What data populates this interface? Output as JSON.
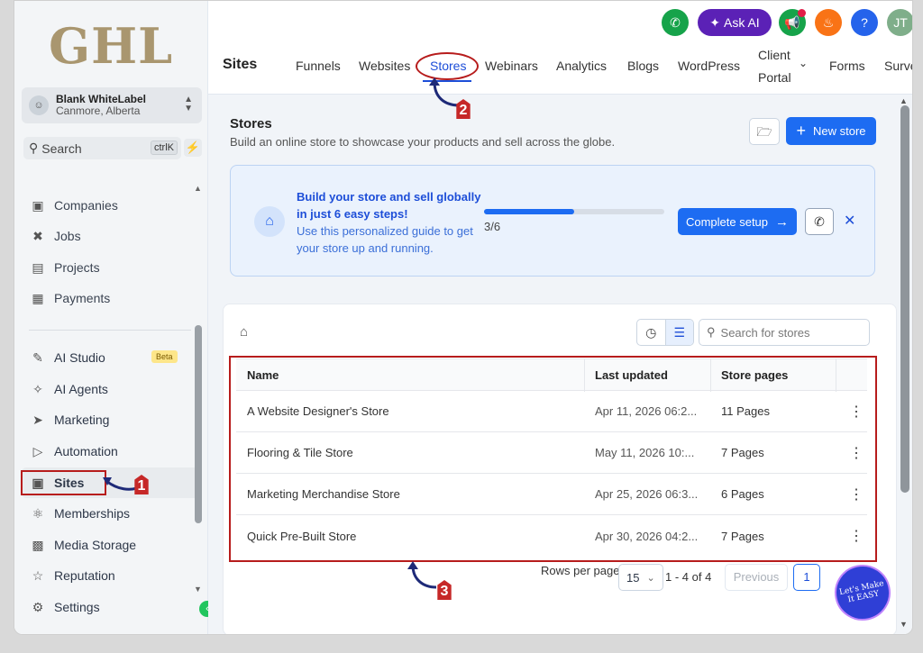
{
  "logo": "GHL",
  "account": {
    "name": "Blank WhiteLabel",
    "location": "Canmore, Alberta"
  },
  "search": {
    "label": "Search",
    "shortcut": "ctrlK"
  },
  "sidebar": {
    "items": [
      {
        "label": "Companies",
        "icon": "building-icon"
      },
      {
        "label": "Jobs",
        "icon": "tools-icon"
      },
      {
        "label": "Projects",
        "icon": "briefcase-icon"
      },
      {
        "label": "Payments",
        "icon": "invoice-icon"
      },
      {
        "label": "AI Studio",
        "icon": "ai-studio-icon"
      },
      {
        "label": "AI Agents",
        "icon": "sparkle-icon"
      },
      {
        "label": "Marketing",
        "icon": "send-icon"
      },
      {
        "label": "Automation",
        "icon": "automation-icon"
      },
      {
        "label": "Sites",
        "icon": "sites-icon"
      },
      {
        "label": "Memberships",
        "icon": "badge-icon"
      },
      {
        "label": "Media Storage",
        "icon": "image-icon"
      },
      {
        "label": "Reputation",
        "icon": "star-icon"
      },
      {
        "label": "Settings",
        "icon": "gear-icon"
      }
    ],
    "beta_label": "Beta"
  },
  "header": {
    "ask_ai": "Ask AI",
    "help": "?",
    "user_initials": "JT",
    "section_title": "Sites",
    "tabs": [
      {
        "label": "Funnels"
      },
      {
        "label": "Websites"
      },
      {
        "label": "Stores"
      },
      {
        "label": "Webinars"
      },
      {
        "label": "Analytics"
      },
      {
        "label": "Blogs"
      },
      {
        "label": "WordPress"
      },
      {
        "label": "Client"
      },
      {
        "label": "Portal"
      },
      {
        "label": "Forms"
      },
      {
        "label": "Surveys"
      }
    ]
  },
  "page": {
    "title": "Stores",
    "subtitle": "Build an online store to showcase your products and sell across the globe.",
    "new_store": "New store"
  },
  "setup": {
    "title": "Build your store and sell globally in just 6 easy steps!",
    "desc": "Use this personalized guide to get your store up and running.",
    "progress_label": "3/6",
    "progress_fraction": 0.5,
    "complete_button": "Complete setup"
  },
  "list": {
    "search_placeholder": "Search for stores",
    "columns": [
      "Name",
      "Last updated",
      "Store pages"
    ],
    "rows": [
      {
        "name": "A Website Designer's Store",
        "updated": "Apr 11, 2026 06:2...",
        "pages": "11 Pages"
      },
      {
        "name": "Flooring & Tile Store",
        "updated": "May 11, 2026 10:...",
        "pages": "7 Pages"
      },
      {
        "name": "Marketing Merchandise Store",
        "updated": "Apr 25, 2026 06:3...",
        "pages": "6 Pages"
      },
      {
        "name": "Quick Pre-Built Store",
        "updated": "Apr 30, 2026 04:2...",
        "pages": "7 Pages"
      }
    ],
    "rows_per_page_label": "Rows per page",
    "rows_per_page": "15",
    "range": "1 - 4 of 4",
    "previous": "Previous",
    "current_page": "1"
  },
  "callouts": [
    "1",
    "2",
    "3"
  ],
  "watermark": "Let's Make It EASY",
  "colors": {
    "accent": "#1d6cf2",
    "callout": "#b71c1c",
    "logo": "#a9966f"
  }
}
